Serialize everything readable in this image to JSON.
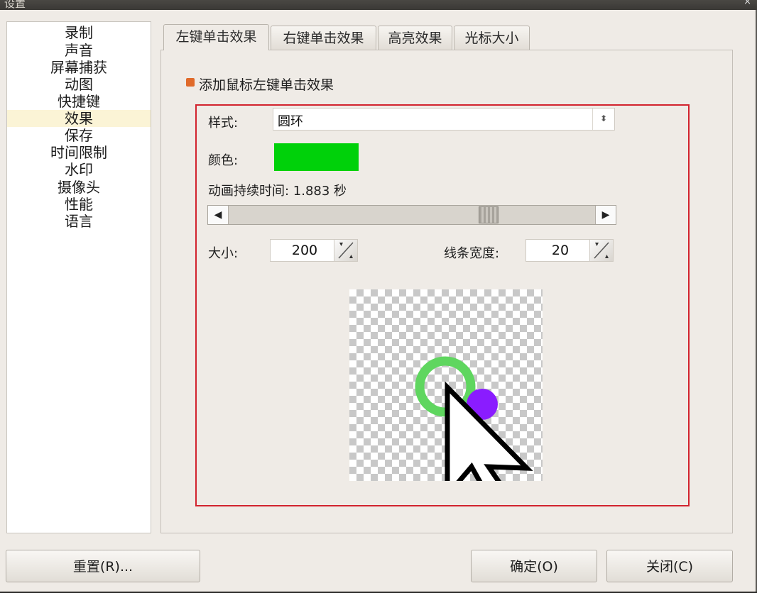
{
  "window": {
    "title": "设置",
    "close_glyph": "×"
  },
  "sidebar": {
    "selected_index": 5,
    "items": [
      {
        "label": "录制"
      },
      {
        "label": "声音"
      },
      {
        "label": "屏幕捕获"
      },
      {
        "label": "动图"
      },
      {
        "label": "快捷键"
      },
      {
        "label": "效果"
      },
      {
        "label": "保存"
      },
      {
        "label": "时间限制"
      },
      {
        "label": "水印"
      },
      {
        "label": "摄像头"
      },
      {
        "label": "性能"
      },
      {
        "label": "语言"
      }
    ]
  },
  "tabs": [
    {
      "label": "左键单击效果",
      "active": true
    },
    {
      "label": "右键单击效果",
      "active": false
    },
    {
      "label": "高亮效果",
      "active": false
    },
    {
      "label": "光标大小",
      "active": false
    }
  ],
  "effect": {
    "enable_label": "添加鼠标左键单击效果",
    "enabled": true,
    "style_label": "样式:",
    "style_value": "圆环",
    "color_label": "颜色:",
    "color_value": "#00d10a",
    "duration_label": "动画持续时间: 1.883 秒",
    "duration_fraction": 0.72,
    "size_label": "大小:",
    "size_value": "200",
    "line_width_label": "线条宽度:",
    "line_width_value": "20"
  },
  "preview": {
    "ring_color": "#5fd65f",
    "dot_color": "#8a1cff",
    "cursor_icon": "arrow-cursor-icon"
  },
  "buttons": {
    "reset": "重置(R)...",
    "ok": "确定(O)",
    "close": "关闭(C)"
  }
}
